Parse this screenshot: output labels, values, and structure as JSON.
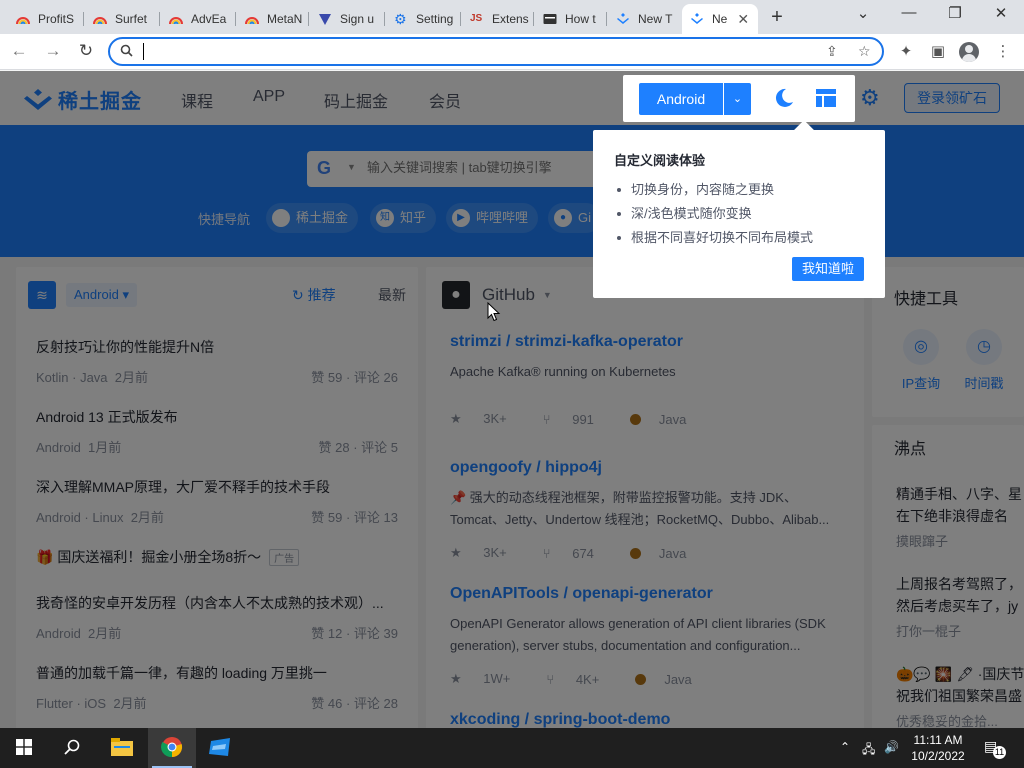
{
  "browser": {
    "tabs": [
      {
        "label": "ProfitS",
        "icon": "rainbow-icon"
      },
      {
        "label": "Surfet",
        "icon": "rainbow-icon"
      },
      {
        "label": "AdvEa",
        "icon": "rainbow-icon"
      },
      {
        "label": "MetaN",
        "icon": "rainbow-icon"
      },
      {
        "label": "Sign u",
        "icon": "triangle-icon"
      },
      {
        "label": "Setting",
        "icon": "gear-icon"
      },
      {
        "label": "Extens",
        "icon": "js-icon"
      },
      {
        "label": "How t",
        "icon": "terminal-icon"
      },
      {
        "label": "New T",
        "icon": "juejin-icon"
      },
      {
        "label": "Ne",
        "icon": "juejin-icon",
        "active": true
      }
    ],
    "address_value": "",
    "colors": {
      "tabstrip": "#dee1e6",
      "accent": "#1a73e8"
    }
  },
  "site": {
    "logo_text": "稀土掘金",
    "nav": [
      "课程",
      "APP",
      "码上掘金",
      "会员"
    ],
    "login": "登录领矿石",
    "brand_color": "#1e80ff"
  },
  "banner": {
    "search_placeholder": "输入关键词搜索 | tab键切换引擎",
    "quick_label": "快捷导航",
    "quick_links": [
      "稀土掘金",
      "知乎",
      "哔哩哔哩",
      "Gi"
    ]
  },
  "feed": {
    "role": "Android",
    "recommend": "推荐",
    "newest": "最新",
    "articles": [
      {
        "title": "反射技巧让你的性能提升N倍",
        "tags": "Kotlin · Java",
        "time": "2月前",
        "stats": "赞 59 · 评论 26"
      },
      {
        "title": "Android 13 正式版发布",
        "tags": "Android",
        "time": "1月前",
        "stats": "赞 28 · 评论 5"
      },
      {
        "title": "深入理解MMAP原理，大厂爱不释手的技术手段",
        "tags": "Android · Linux",
        "time": "2月前",
        "stats": "赞 59 · 评论 13"
      },
      {
        "title": "🎁 国庆送福利！掘金小册全场8折～",
        "ad": "广告"
      },
      {
        "title": "我奇怪的安卓开发历程（内含本人不太成熟的技术观）...",
        "tags": "Android",
        "time": "2月前",
        "stats": "赞 12 · 评论 39"
      },
      {
        "title": "普通的加载千篇一律，有趣的 loading 万里挑一",
        "tags": "Flutter · iOS",
        "time": "2月前",
        "stats": "赞 46 · 评论 28"
      }
    ]
  },
  "github": {
    "name": "GitHub",
    "repos": [
      {
        "title": "strimzi / strimzi-kafka-operator",
        "desc": "Apache Kafka® running on Kubernetes",
        "stars": "3K+",
        "forks": "991",
        "lang": "Java"
      },
      {
        "title": "opengoofy / hippo4j",
        "desc": "📌 强大的动态线程池框架，附带监控报警功能。支持 JDK、Tomcat、Jetty、Undertow 线程池；RocketMQ、Dubbo、Alibab...",
        "stars": "3K+",
        "forks": "674",
        "lang": "Java"
      },
      {
        "title": "OpenAPITools / openapi-generator",
        "desc": "OpenAPI Generator allows generation of API client libraries (SDK generation), server stubs, documentation and configuration...",
        "stars": "1W+",
        "forks": "4K+",
        "lang": "Java"
      },
      {
        "title": "xkcoding / spring-boot-demo"
      }
    ]
  },
  "sidebar": {
    "tools_title": "快捷工具",
    "tools": [
      "IP查询",
      "时间戳"
    ],
    "feed_title": "沸点",
    "feed": [
      {
        "text": "精通手相、八字、星",
        "text2": "在下绝非浪得虚名",
        "author": "摸眼蹿子"
      },
      {
        "text": "上周报名考驾照了，",
        "text2": "然后考虑买车了，jy",
        "author": "打你一棍子"
      },
      {
        "text": "🎃💬 🎇 🖋 ·国庆节",
        "text2": "祝我们祖国繁荣昌盛",
        "author": "优秀稳妥的金拾..."
      }
    ]
  },
  "popup": {
    "role_button": "Android",
    "title": "自定义阅读体验",
    "items": [
      "切换身份，内容随之更换",
      "深/浅色模式随你变换",
      "根据不同喜好切换不同布局模式"
    ],
    "ok": "我知道啦"
  },
  "taskbar": {
    "time": "11:11 AM",
    "date": "10/2/2022",
    "notifications": "11"
  }
}
